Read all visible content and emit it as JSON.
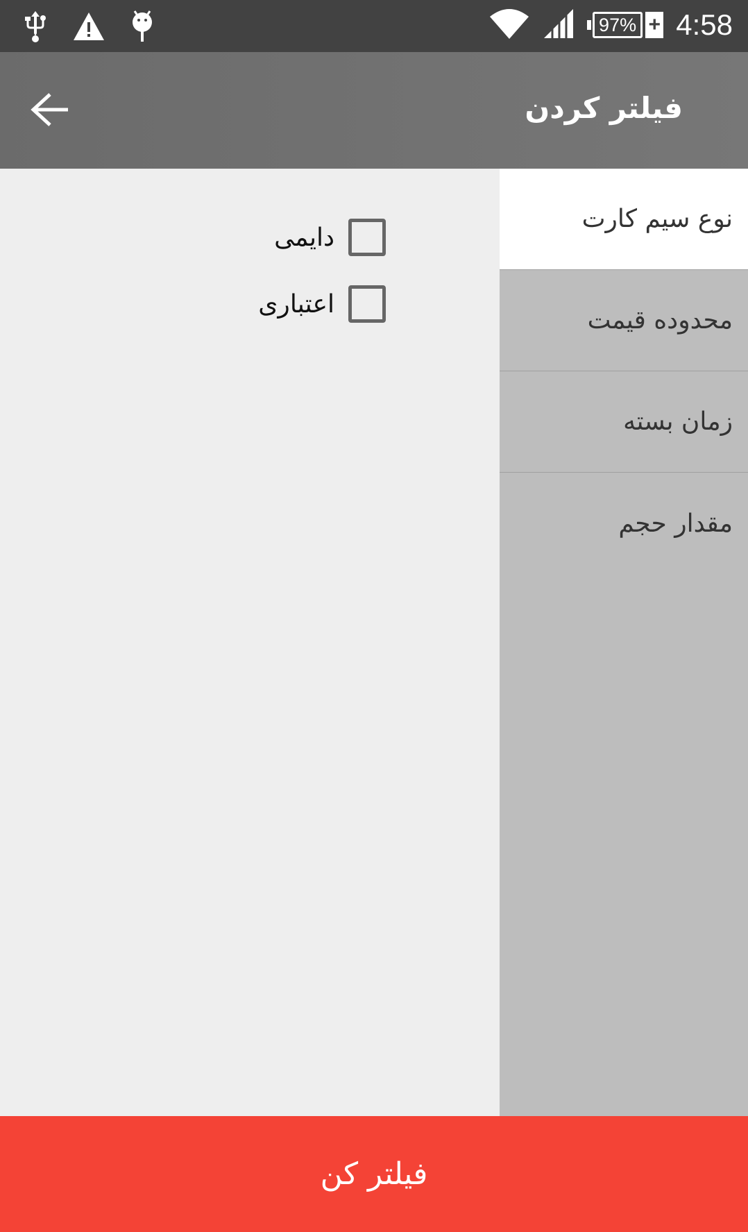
{
  "status_bar": {
    "time": "4:58",
    "battery": "97%",
    "icons": [
      "usb-icon",
      "warning-icon",
      "android-icon",
      "wifi-icon",
      "signal-icon",
      "battery-icon"
    ]
  },
  "app_bar": {
    "title": "فیلتر کردن",
    "back_icon": "arrow-back-icon"
  },
  "options": [
    {
      "label": "دایمی",
      "checked": false
    },
    {
      "label": "اعتباری",
      "checked": false
    }
  ],
  "tabs": [
    {
      "label": "نوع سیم کارت",
      "active": true
    },
    {
      "label": "محدوده قیمت",
      "active": false
    },
    {
      "label": "زمان بسته",
      "active": false
    },
    {
      "label": "مقدار حجم",
      "active": false
    }
  ],
  "filter_button": {
    "label": "فیلتر کن"
  },
  "colors": {
    "accent": "#f44336",
    "app_bar": "#757575",
    "status_bar": "#424242",
    "tabs_bg": "#bdbdbd"
  }
}
